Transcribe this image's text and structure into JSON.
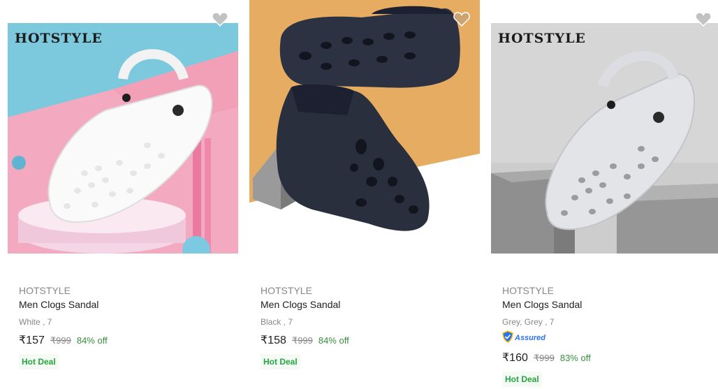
{
  "colors": {
    "price": "#212121",
    "muted": "#878787",
    "discount": "#388e3c",
    "deal_text": "#26a541",
    "deal_bg": "#f4fbf5",
    "assured_blue": "#2874f0"
  },
  "products": [
    {
      "image_brand": "HOTSTYLE",
      "brand": "HOTSTYLE",
      "title": "Men Clogs Sandal",
      "variant": "White , 7",
      "price": "₹157",
      "mrp": "₹999",
      "discount": "84% off",
      "badge": "Hot Deal"
    },
    {
      "brand": "HOTSTYLE",
      "title": "Men Clogs Sandal",
      "variant": "Black , 7",
      "price": "₹158",
      "mrp": "₹999",
      "discount": "84% off",
      "badge": "Hot Deal"
    },
    {
      "image_brand": "HOTSTYLE",
      "brand": "HOTSTYLE",
      "title": "Men Clogs Sandal",
      "variant": "Grey, Grey , 7",
      "assured_label": "Assured",
      "price": "₹160",
      "mrp": "₹999",
      "discount": "83% off",
      "badge": "Hot Deal"
    }
  ]
}
